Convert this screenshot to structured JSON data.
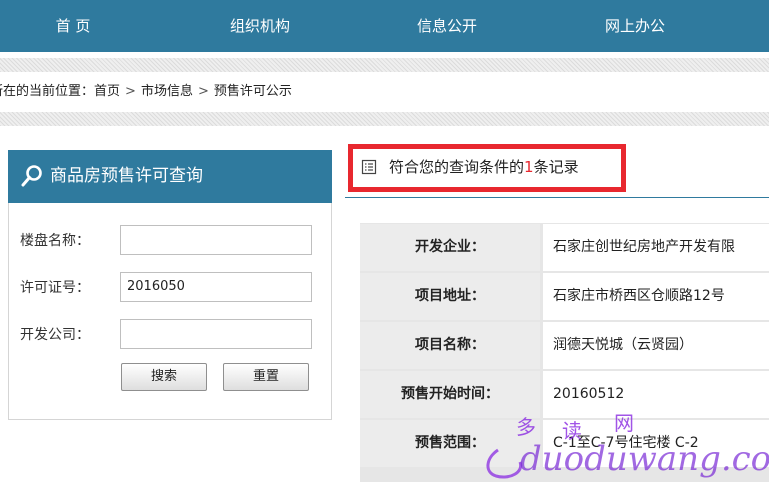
{
  "nav": {
    "items": [
      "首 页",
      "组织机构",
      "信息公开",
      "网上办公"
    ]
  },
  "breadcrumb": {
    "prefix": "所在的当前位置：",
    "items": [
      "首页",
      "市场信息",
      "预售许可公示"
    ],
    "separator": ">"
  },
  "search_panel": {
    "title": "商品房预售许可查询",
    "icon": "search-icon",
    "fields": [
      {
        "label": "楼盘名称：",
        "value": ""
      },
      {
        "label": "许可证号：",
        "value": "2016050"
      },
      {
        "label": "开发公司：",
        "value": ""
      }
    ],
    "search_button": "搜索",
    "reset_button": "重置"
  },
  "result": {
    "icon": "list-icon",
    "text_before": "符合您的查询条件的",
    "count": "1",
    "text_after": "条记录",
    "highlight_color": "#e8282f"
  },
  "detail_rows": [
    {
      "label": "开发企业：",
      "value": "石家庄创世纪房地产开发有限"
    },
    {
      "label": "项目地址：",
      "value": "石家庄市桥西区仓顺路12号"
    },
    {
      "label": "项目名称：",
      "value": "润德天悦城（云贤园）"
    },
    {
      "label": "预售开始时间：",
      "value": "20160512"
    },
    {
      "label": "预售范围：",
      "value": "C-1至C-7号住宅楼 C-2"
    }
  ],
  "watermark": {
    "cn": "多读网",
    "en": "duoduwang.com"
  },
  "colors": {
    "nav": "#2f7a9e",
    "accent_red": "#e8282f",
    "table_bg": "#ececec"
  }
}
